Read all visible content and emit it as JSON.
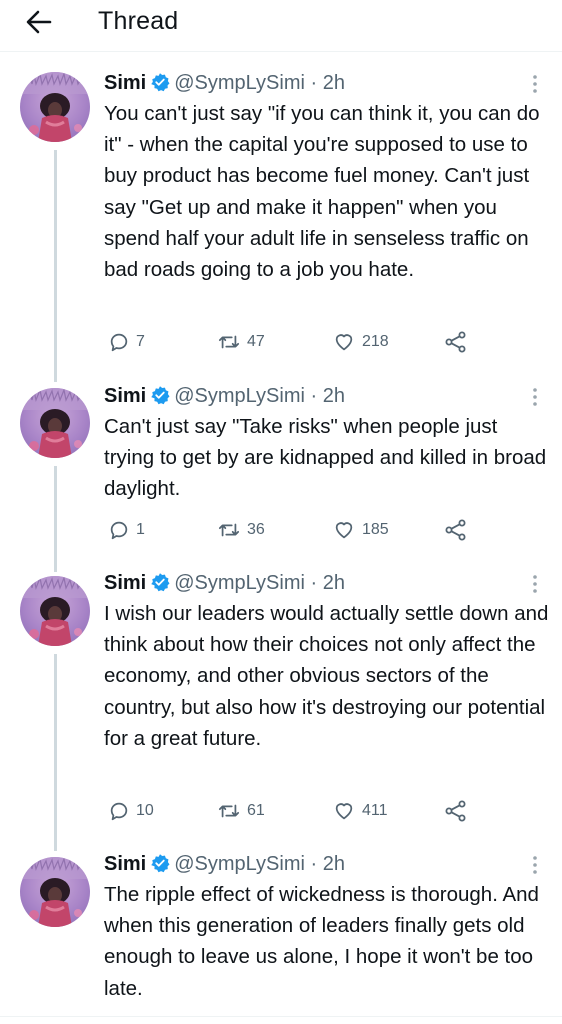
{
  "header": {
    "title": "Thread"
  },
  "colors": {
    "verified": "#1d9bf0",
    "muted": "#536471",
    "thread_line": "#cfd9de"
  },
  "tweets": [
    {
      "name": "Simi",
      "handle": "@SympLySimi",
      "separator": "·",
      "time": "2h",
      "text": "You can't just say \"if you can think it, you can do it\" - when the capital you're supposed to use to buy product has become fuel money. Can't just say \"Get up and make it happen\" when you spend half your adult life in senseless traffic on bad roads going to a job you hate.",
      "replies": "7",
      "retweets": "47",
      "likes": "218"
    },
    {
      "name": "Simi",
      "handle": "@SympLySimi",
      "separator": "·",
      "time": "2h",
      "text": "Can't just say \"Take risks\" when people just trying to get by are kidnapped and killed in broad daylight.",
      "replies": "1",
      "retweets": "36",
      "likes": "185"
    },
    {
      "name": "Simi",
      "handle": "@SympLySimi",
      "separator": "·",
      "time": "2h",
      "text": "I wish our leaders would actually settle down and think about how their choices not only affect the economy, and other obvious sectors of the country, but also how it's destroying our potential for a great future.",
      "replies": "10",
      "retweets": "61",
      "likes": "411"
    },
    {
      "name": "Simi",
      "handle": "@SympLySimi",
      "separator": "·",
      "time": "2h",
      "text": "The ripple effect of wickedness is thorough. And when this generation of leaders finally gets old enough to leave us alone, I hope it won't be too late."
    }
  ]
}
